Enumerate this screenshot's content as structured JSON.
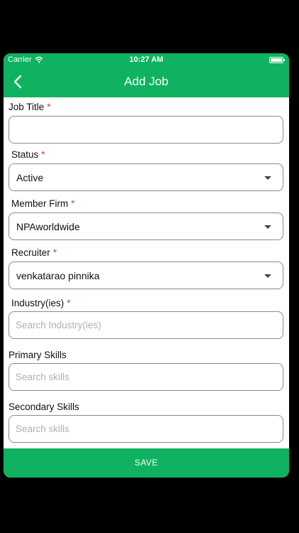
{
  "status_bar": {
    "carrier": "Carrier",
    "time": "10:27 AM"
  },
  "nav": {
    "title": "Add Job"
  },
  "form": {
    "job_title": {
      "label": "Job Title",
      "value": ""
    },
    "status": {
      "label": "Status",
      "value": "Active"
    },
    "member_firm": {
      "label": "Member Firm",
      "value": "NPAworldwide"
    },
    "recruiter": {
      "label": "Recruiter",
      "value": "venkatarao pinnika"
    },
    "industries": {
      "label": "Industry(ies)",
      "placeholder": "Search Industry(ies)"
    },
    "primary_skills": {
      "label": "Primary Skills",
      "placeholder": "Search skills"
    },
    "secondary_skills": {
      "label": "Secondary Skills",
      "placeholder": "Search skills"
    },
    "required_marker": "*"
  },
  "actions": {
    "save_label": "SAVE"
  },
  "colors": {
    "brand": "#0fb261",
    "required": "#e53935"
  }
}
